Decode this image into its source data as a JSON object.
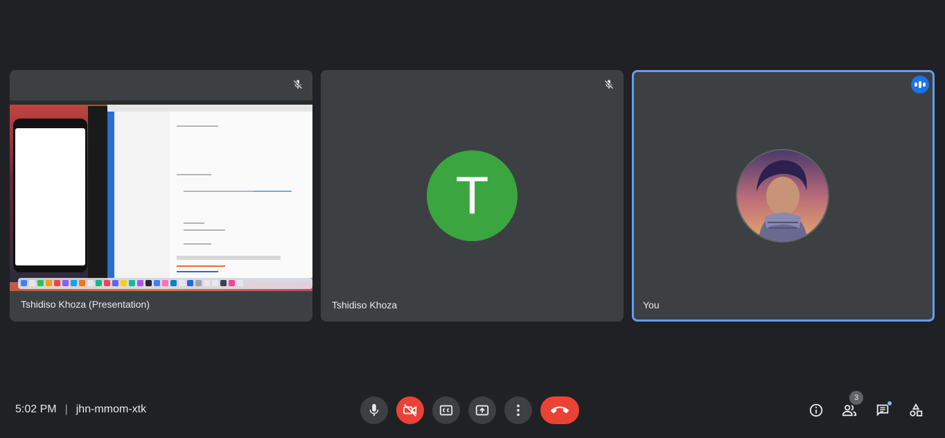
{
  "participants": [
    {
      "name": "Tshidiso Khoza (Presentation)",
      "muted": true
    },
    {
      "name": "Tshidiso Khoza",
      "initial": "T",
      "avatar_color": "#3ba640",
      "muted": true
    },
    {
      "name": "You",
      "speaking": true,
      "highlight_color": "#669df6"
    }
  ],
  "meeting": {
    "time": "5:02 PM",
    "separator": "|",
    "code": "jhn-mmom-xtk"
  },
  "controls": {
    "mic_icon": "microphone-icon",
    "camera_icon": "camera-off-icon",
    "captions_icon": "captions-icon",
    "present_icon": "present-screen-icon",
    "more_icon": "more-options-icon",
    "end_icon": "end-call-icon"
  },
  "side_panel": {
    "people_count": "3",
    "info_icon": "info-icon",
    "people_icon": "people-icon",
    "chat_icon": "chat-icon",
    "activities_icon": "activities-icon"
  },
  "colors": {
    "background": "#202124",
    "tile": "#3c4043",
    "end_call": "#ea4335",
    "accent": "#1a73e8"
  }
}
